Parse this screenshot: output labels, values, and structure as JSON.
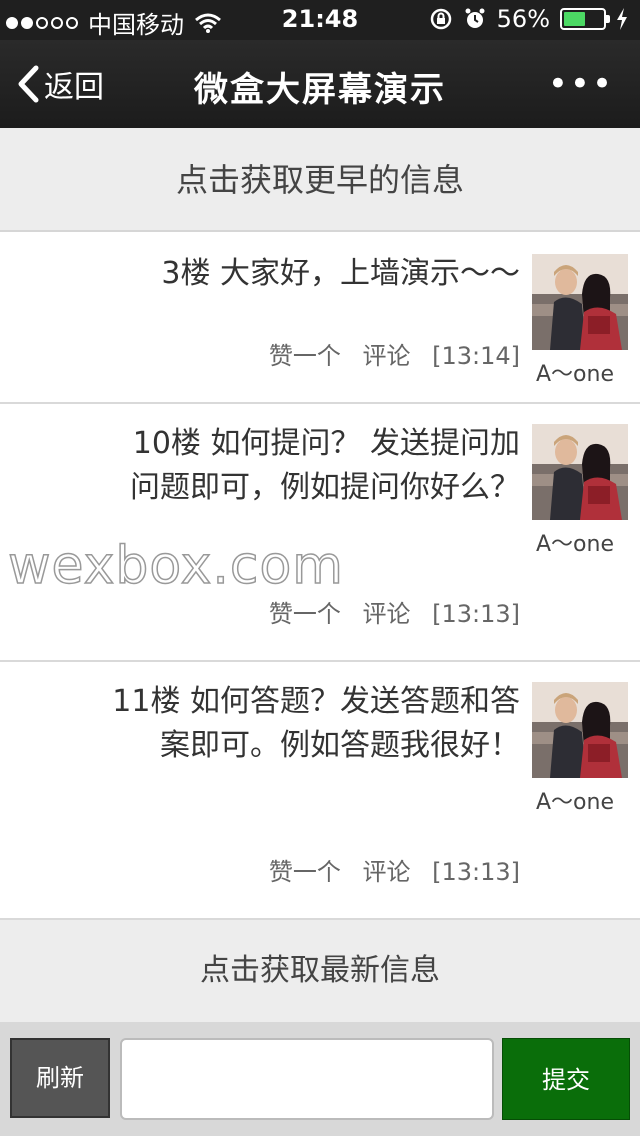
{
  "status_bar": {
    "carrier": "中国移动",
    "time": "21:48",
    "battery_percent": "56%",
    "battery_level": 0.56,
    "signal_full_dots": 2,
    "signal_total_dots": 5
  },
  "nav": {
    "back_label": "返回",
    "title": "微盒大屏幕演示",
    "more_label": "•••"
  },
  "load_earlier_label": "点击获取更早的信息",
  "load_newest_label": "点击获取最新信息",
  "watermark": "wexbox.com",
  "messages": [
    {
      "text": "3楼 大家好，上墙演示～～",
      "like": "赞一个",
      "comment": "评论",
      "time": "[13:14]",
      "author": "A～one"
    },
    {
      "text": "10楼 如何提问？ 发送提问加问题即可，例如提问你好么？",
      "like": "赞一个",
      "comment": "评论",
      "time": "[13:13]",
      "author": "A～one"
    },
    {
      "text": "11楼 如何答题？发送答题和答案即可。例如答题我很好！",
      "like": "赞一个",
      "comment": "评论",
      "time": "[13:13]",
      "author": "A～one"
    }
  ],
  "toolbar": {
    "refresh_label": "刷新",
    "input_value": "",
    "submit_label": "提交"
  },
  "colors": {
    "nav_bg": "#1f1f1f",
    "submit_bg": "#0a6e0a",
    "refresh_bg": "#555555",
    "battery_fill": "#4cd964"
  }
}
